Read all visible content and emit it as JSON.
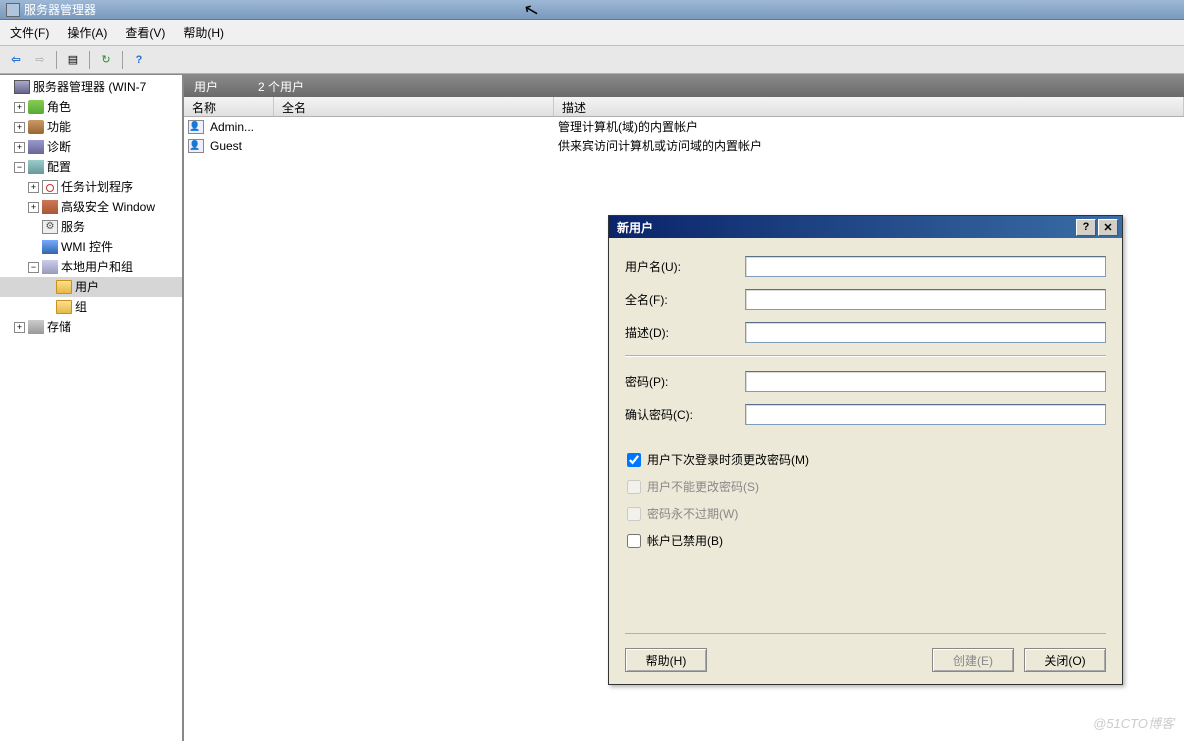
{
  "window": {
    "title": "服务器管理器"
  },
  "menubar": {
    "file": "文件(F)",
    "action": "操作(A)",
    "view": "查看(V)",
    "help": "帮助(H)"
  },
  "toolbar": {
    "back": "⇦",
    "forward": "⇨",
    "up": "▤",
    "refresh": "↻",
    "help": "?"
  },
  "tree": {
    "root": "服务器管理器 (WIN-7",
    "roles": "角色",
    "features": "功能",
    "diagnostics": "诊断",
    "config": "配置",
    "task_scheduler": "任务计划程序",
    "firewall": "高级安全 Window",
    "services": "服务",
    "wmi": "WMI 控件",
    "local_users_groups": "本地用户和组",
    "users": "用户",
    "groups": "组",
    "storage": "存储"
  },
  "content": {
    "header_title": "用户",
    "header_count": "2 个用户",
    "columns": {
      "name": "名称",
      "fullname": "全名",
      "desc": "描述"
    },
    "rows": [
      {
        "name": "Admin...",
        "full": "",
        "desc": "管理计算机(域)的内置帐户"
      },
      {
        "name": "Guest",
        "full": "",
        "desc": "供来宾访问计算机或访问域的内置帐户"
      }
    ]
  },
  "dialog": {
    "title": "新用户",
    "username_label": "用户名(U):",
    "fullname_label": "全名(F):",
    "desc_label": "描述(D):",
    "password_label": "密码(P):",
    "confirm_label": "确认密码(C):",
    "chk_must_change": "用户下次登录时须更改密码(M)",
    "chk_cannot_change": "用户不能更改密码(S)",
    "chk_never_expire": "密码永不过期(W)",
    "chk_disabled": "帐户已禁用(B)",
    "btn_help": "帮助(H)",
    "btn_create": "创建(E)",
    "btn_close": "关闭(O)",
    "help_symbol": "?",
    "close_symbol": "✕"
  },
  "watermark": "@51CTO博客"
}
